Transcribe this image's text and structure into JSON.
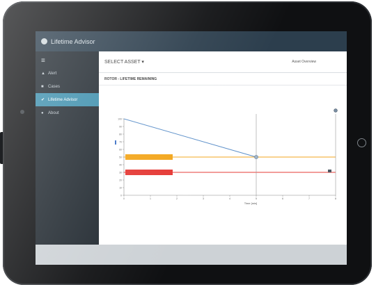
{
  "app": {
    "title": "Lifetime Advisor"
  },
  "sidebar": {
    "menu_glyph": "≡",
    "items": [
      {
        "label": "Alert",
        "icon": "person-icon",
        "glyph": "▲",
        "active": false
      },
      {
        "label": "Cases",
        "icon": "folder-icon",
        "glyph": "■",
        "active": false
      },
      {
        "label": "Lifetime Advisor",
        "icon": "chart-icon",
        "glyph": "✔",
        "active": true
      },
      {
        "label": "About",
        "icon": "info-icon",
        "glyph": "●",
        "active": false
      }
    ]
  },
  "header": {
    "select_asset": "SELECT ASSET ▾",
    "overview_link": "Asset Overview"
  },
  "panel": {
    "title": "ROTOR - LIFETIME REMAINING"
  },
  "chart_data": {
    "type": "line",
    "xlabel": "Time [min]",
    "ylabel": "",
    "ylim": [
      0,
      100
    ],
    "yticks": [
      0,
      10,
      20,
      30,
      40,
      50,
      60,
      70,
      80,
      90,
      100
    ],
    "xticks": [
      0,
      1,
      2,
      3,
      4,
      5,
      6,
      7,
      8
    ],
    "xlim": [
      0,
      8
    ],
    "series": [
      {
        "x": [
          0,
          5
        ],
        "y": [
          100,
          50
        ],
        "color": "#5b8fc9"
      }
    ],
    "thresholds": [
      {
        "y": 50,
        "color": "#f3a61c",
        "label": ""
      },
      {
        "y": 30,
        "color": "#e53935",
        "label": ""
      }
    ],
    "markers": [
      {
        "x": 5
      },
      {
        "x": 8
      }
    ],
    "grid": false
  },
  "colors": {
    "titlebar": "#2c3e4d",
    "sidebar": "#222a31",
    "active": "#3d8fad",
    "warning": "#f3a61c",
    "critical": "#e53935"
  }
}
